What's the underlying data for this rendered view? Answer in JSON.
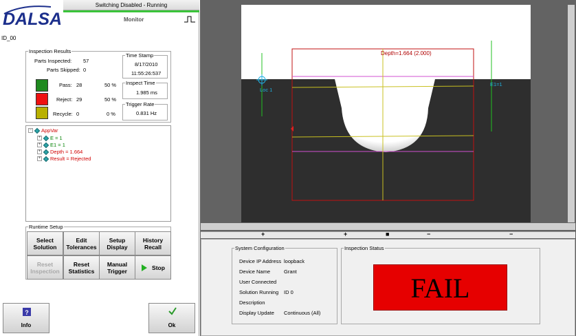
{
  "header": {
    "status_text": "Switching Disabled - Running",
    "logo": "DALSA",
    "mode_label": "Monitor",
    "device_id": "ID_00"
  },
  "inspection_results": {
    "legend": "Inspection Results",
    "parts_inspected_label": "Parts Inspected:",
    "parts_inspected": "57",
    "parts_skipped_label": "Parts Skipped:",
    "parts_skipped": "0",
    "pass_label": "Pass:",
    "pass_count": "28",
    "pass_pct": "50 %",
    "reject_label": "Reject:",
    "reject_count": "29",
    "reject_pct": "50 %",
    "recycle_label": "Recycle:",
    "recycle_count": "0",
    "recycle_pct": "0 %",
    "colors": {
      "pass": "#1f8a1f",
      "reject": "#ee1111",
      "recycle": "#b8b000"
    }
  },
  "timestamp": {
    "legend": "Time Stamp",
    "date": "8/17/2010",
    "time": "11:55:26:537"
  },
  "inspect_time": {
    "legend": "Inspect Time",
    "value": "1.985 ms"
  },
  "trigger_rate": {
    "legend": "Trigger Rate",
    "value": "0.831 Hz"
  },
  "tree": {
    "root": "AppVar",
    "items": [
      {
        "label": "E = 1",
        "color": "#008000"
      },
      {
        "label": "E1 = 1",
        "color": "#008000"
      },
      {
        "label": "Depth = 1.664",
        "color": "#d00000"
      },
      {
        "label": "Result = Rejected",
        "color": "#d00000"
      }
    ]
  },
  "runtime_setup": {
    "legend": "Runtime Setup",
    "buttons": [
      {
        "line1": "Select",
        "line2": "Solution"
      },
      {
        "line1": "Edit",
        "line2": "Tolerances"
      },
      {
        "line1": "Setup",
        "line2": "Display"
      },
      {
        "line1": "History",
        "line2": "Recall"
      },
      {
        "line1": "Reset",
        "line2": "Inspection"
      },
      {
        "line1": "Reset",
        "line2": "Statistics"
      },
      {
        "line1": "Manual",
        "line2": "Trigger"
      },
      {
        "line1": "Stop",
        "line2": ""
      }
    ]
  },
  "bottom_buttons": {
    "info": "Info",
    "ok": "Ok"
  },
  "overlay": {
    "depth_label": "Depth=1.664 (2.000)",
    "loc_label": "Loc 1",
    "e_label": "E1=1",
    "edge_label": "E1"
  },
  "zoom_controls": [
    "+",
    "+",
    "■",
    "−",
    "−"
  ],
  "system_config": {
    "legend": "System Configuration",
    "rows": [
      {
        "label": "Device IP Address",
        "value": "loopback"
      },
      {
        "label": "Device Name",
        "value": "Grant"
      },
      {
        "label": "User Connected",
        "value": ""
      },
      {
        "label": "Solution Running",
        "value": "ID 0"
      },
      {
        "label": "Description",
        "value": ""
      },
      {
        "label": "Display Update",
        "value": "Continuous (All)"
      }
    ]
  },
  "inspection_status": {
    "legend": "Inspection Status",
    "result": "FAIL",
    "color": "#e60000"
  }
}
